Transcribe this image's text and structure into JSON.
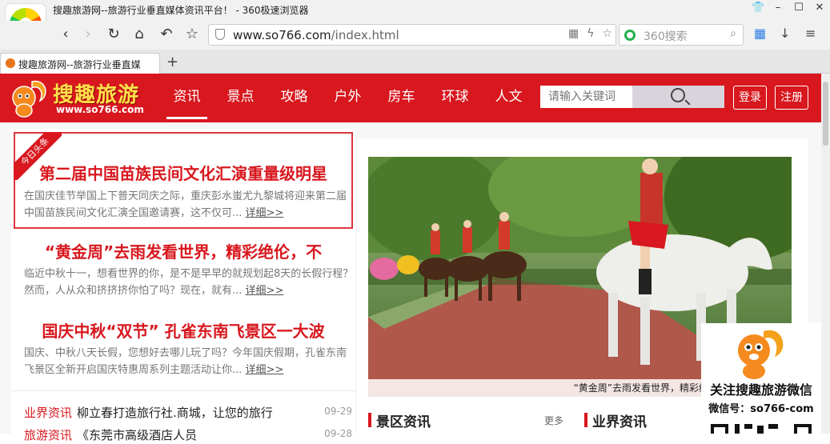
{
  "window": {
    "title": "搜趣旅游网--旅游行业垂直媒体资讯平台！ - 360极速浏览器",
    "controls": [
      "shirt-icon",
      "minimize-icon",
      "maximize-icon",
      "close-icon"
    ]
  },
  "toolbar": {
    "url_host": "www.so766.com",
    "url_path": "/index.html",
    "search_placeholder": "360搜索"
  },
  "tab": {
    "title": "搜趣旅游网--旅游行业垂直媒"
  },
  "site": {
    "logo_text": "搜趣旅游",
    "logo_url": "www.so766.com",
    "nav": [
      "资讯",
      "景点",
      "攻略",
      "户外",
      "房车",
      "环球",
      "人文"
    ],
    "search_placeholder": "请输入关键词",
    "login": "登录",
    "register": "注册"
  },
  "headline": {
    "ribbon": "今日头条",
    "stories": [
      {
        "title": "第二届中国苗族民间文化汇演重量级明星",
        "summary": "在国庆佳节举国上下普天同庆之际，重庆彭水蚩尤九黎城将迎来第二届中国苗族民间文化汇演全国邀请赛，这不仅可...",
        "more": "详细>>"
      },
      {
        "title": "“黄金周”去雨发看世界，精彩绝伦，不",
        "summary": "临近中秋十一，想看世界的你，是不是早早的就规划起8天的长假行程？然而，人从众和挤挤挤你怕了吗？现在，就有...",
        "more": "详细>>"
      },
      {
        "title": "国庆中秋“双节” 孔雀东南飞景区一大波",
        "summary": "国庆、中秋八天长假，您想好去哪儿玩了吗？今年国庆假期，孔雀东南飞景区全新开启国庆特惠周系列主题活动让你...",
        "more": "详细>>"
      }
    ]
  },
  "news_list": [
    {
      "category": "业界资讯",
      "title": "柳立春打造旅行社.商城，让您的旅行",
      "date": "09-29"
    },
    {
      "category": "旅游资讯",
      "title": "《东莞市高级酒店人员",
      "date": "09-28"
    }
  ],
  "photo": {
    "caption": "“黄金周”去雨发看世界，精彩绝伦，不挤人山人海"
  },
  "sections": {
    "scenic": "景区资讯",
    "scenic_more": "更多",
    "industry": "业界资讯"
  },
  "qr": {
    "title": "关注搜趣旅游微信",
    "account": "微信号：so766-com"
  },
  "colors": {
    "brand_red": "#d8171e",
    "logo_yellow": "#ffe04a"
  }
}
